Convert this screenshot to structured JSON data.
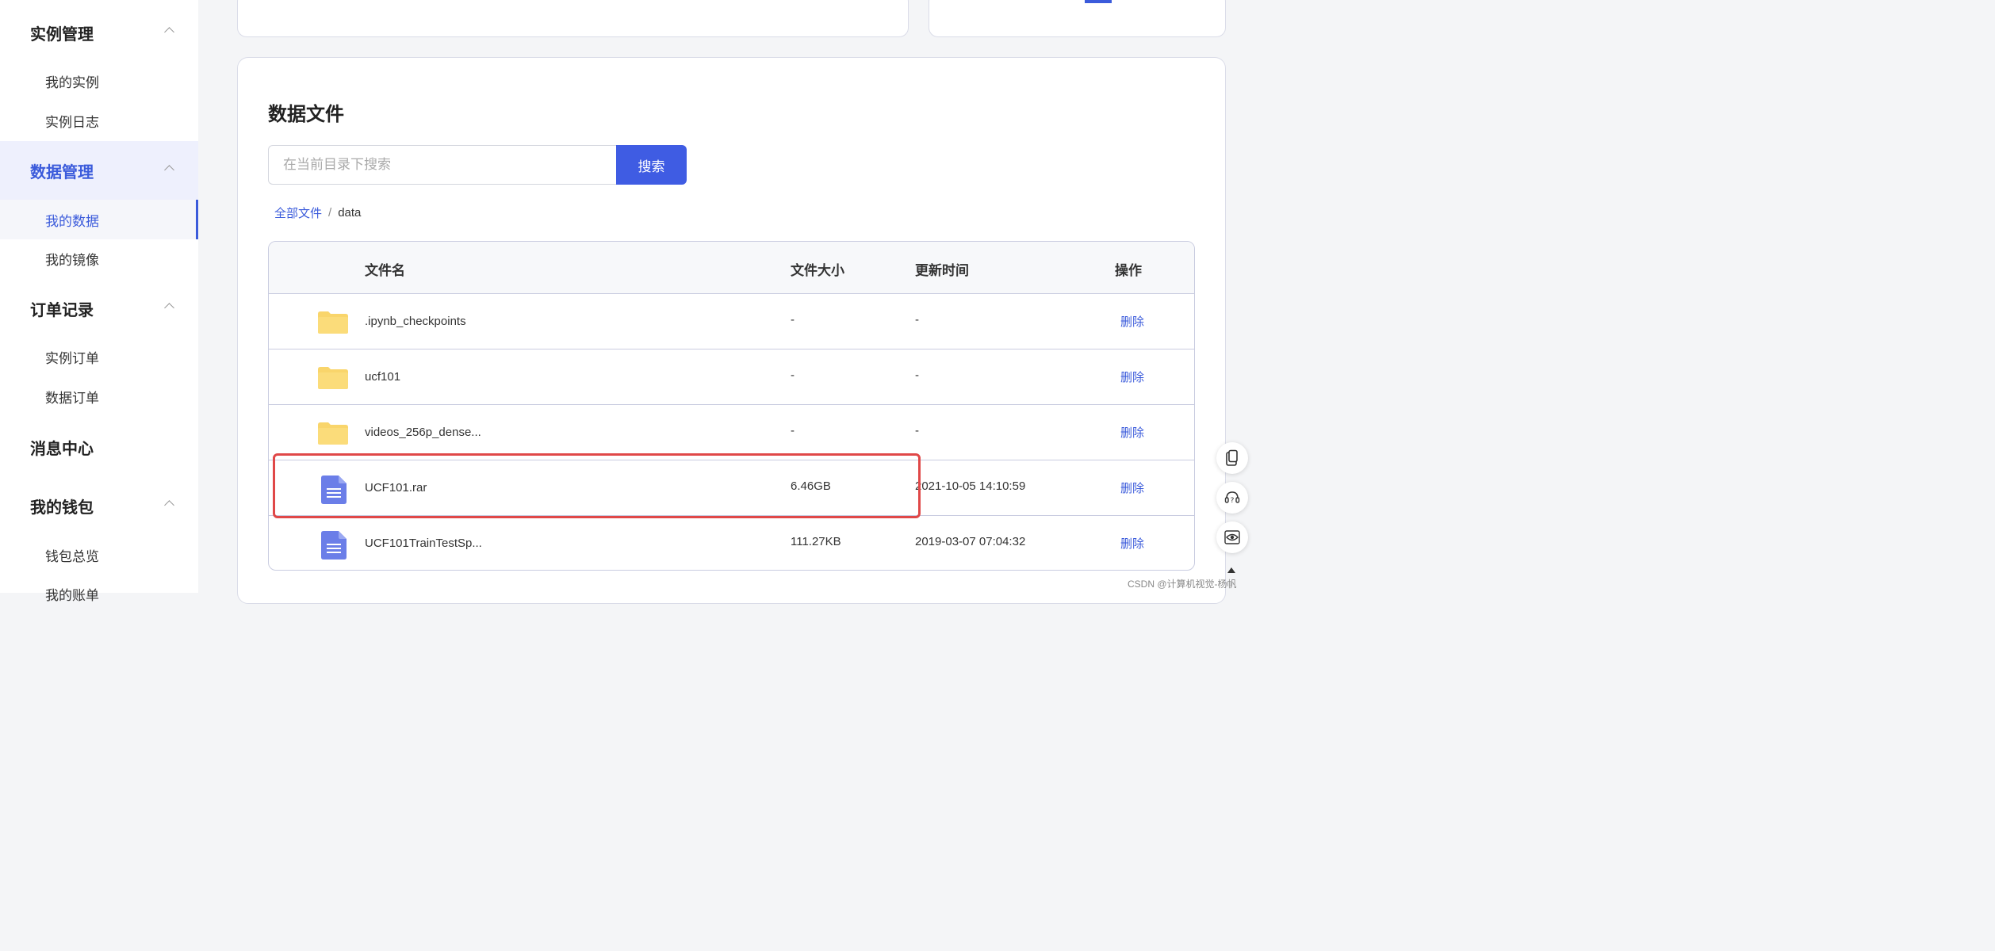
{
  "sidebar": {
    "groups": [
      {
        "label": "实例管理",
        "items": [
          "我的实例",
          "实例日志"
        ]
      },
      {
        "label": "数据管理",
        "items": [
          "我的数据",
          "我的镜像"
        ]
      },
      {
        "label": "订单记录",
        "items": [
          "实例订单",
          "数据订单"
        ]
      },
      {
        "label": "消息中心",
        "items": []
      },
      {
        "label": "我的钱包",
        "items": [
          "钱包总览",
          "我的账单"
        ]
      }
    ]
  },
  "main": {
    "title": "数据文件",
    "search": {
      "placeholder": "在当前目录下搜索",
      "button": "搜索"
    },
    "breadcrumb": {
      "root": "全部文件",
      "sep": "/",
      "current": "data"
    },
    "table": {
      "headers": {
        "name": "文件名",
        "size": "文件大小",
        "time": "更新时间",
        "action": "操作"
      },
      "rows": [
        {
          "type": "folder",
          "name": ".ipynb_checkpoints",
          "size": "-",
          "time": "-",
          "action": "删除"
        },
        {
          "type": "folder",
          "name": "ucf101",
          "size": "-",
          "time": "-",
          "action": "删除"
        },
        {
          "type": "folder",
          "name": "videos_256p_dense...",
          "size": "-",
          "time": "-",
          "action": "删除"
        },
        {
          "type": "file",
          "name": "UCF101.rar",
          "size": "6.46GB",
          "time": "2021-10-05 14:10:59",
          "action": "删除"
        },
        {
          "type": "file",
          "name": "UCF101TrainTestSp...",
          "size": "111.27KB",
          "time": "2019-03-07 07:04:32",
          "action": "删除"
        }
      ]
    }
  },
  "float_buttons": [
    "clipboard-icon",
    "support-icon",
    "eye-icon"
  ],
  "watermark": "CSDN @计算机视觉-杨帆",
  "colors": {
    "accent": "#3f5ce3",
    "highlight": "#e04848",
    "folder": "#f9d56b",
    "file": "#6b7ee8"
  }
}
